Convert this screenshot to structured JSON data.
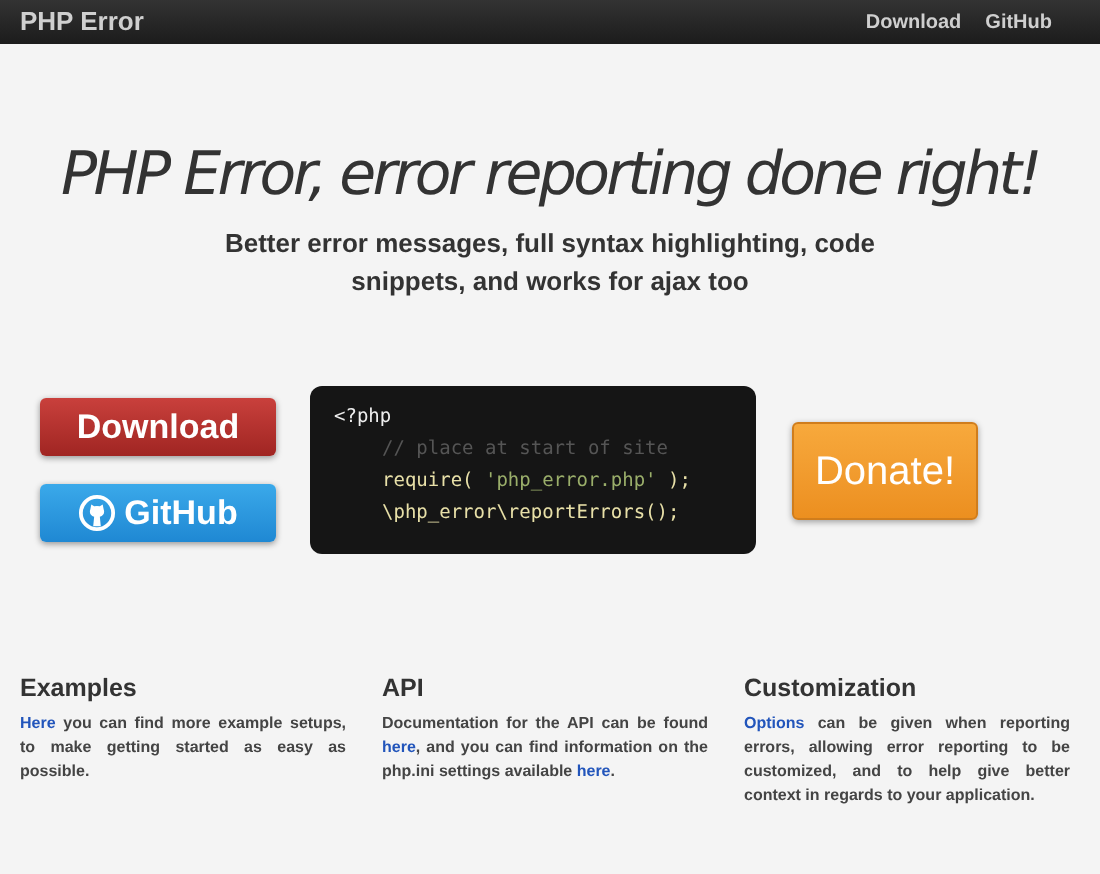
{
  "navbar": {
    "brand": "PHP Error",
    "links": [
      "Download",
      "GitHub"
    ]
  },
  "hero": {
    "title": "PHP Error, error reporting done right!",
    "subtitle": "Better error messages, full syntax highlighting, code snippets, and works for ajax too"
  },
  "buttons": {
    "download": "Download",
    "github": "GitHub",
    "donate": "Donate!"
  },
  "code": [
    {
      "text": "<?php",
      "kind": "plain",
      "indent": false
    },
    {
      "text": "// place at start of site",
      "kind": "comment",
      "indent": true
    },
    {
      "kind": "call",
      "indent": true,
      "parts": [
        "require( ",
        "'php_error.php'",
        " );"
      ]
    },
    {
      "text": "\\php_error\\reportErrors();",
      "kind": "plain-call",
      "indent": true
    }
  ],
  "columns": [
    {
      "heading": "Examples",
      "paragraph": [
        {
          "text": "Here",
          "link": true
        },
        {
          "text": " you can find more example setups, to make getting started as easy as possible.",
          "link": false
        }
      ]
    },
    {
      "heading": "API",
      "paragraph": [
        {
          "text": "Documentation for the API can be found ",
          "link": false
        },
        {
          "text": "here",
          "link": true
        },
        {
          "text": ", and you can find information on the php.ini settings available ",
          "link": false
        },
        {
          "text": "here",
          "link": true
        },
        {
          "text": ".",
          "link": false
        }
      ]
    },
    {
      "heading": "Customization",
      "paragraph": [
        {
          "text": "Options",
          "link": true
        },
        {
          "text": " can be given when reporting errors, allowing error reporting to be customized, and to help give better context in regards to your application.",
          "link": false
        }
      ]
    }
  ]
}
